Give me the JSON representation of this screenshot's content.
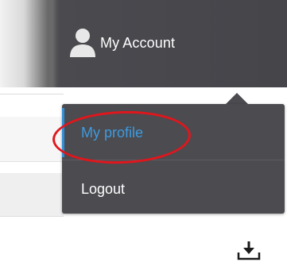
{
  "header": {
    "account_label": "My Account",
    "account_icon": "user-icon"
  },
  "dropdown": {
    "items": [
      {
        "label": "My profile",
        "active": true
      },
      {
        "label": "Logout",
        "active": false
      }
    ]
  },
  "toolbar": {
    "download_icon": "download-icon"
  },
  "colors": {
    "header_bg": "#45454a",
    "dropdown_bg": "#4b4b50",
    "active_text": "#3e9be0",
    "active_border": "#2e8ed6",
    "annotation": "#e0161c"
  }
}
